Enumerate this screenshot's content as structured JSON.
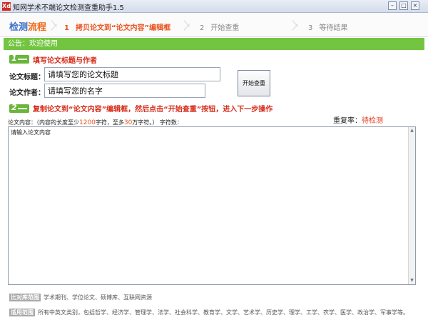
{
  "window": {
    "title": "知网学术不端论文检测查重助手1.5",
    "icon": "app-logo-icon",
    "buttons": [
      "minimize-icon",
      "maximize-icon",
      "close-icon"
    ]
  },
  "steps": {
    "title_part1": "检测",
    "title_part2": "流程",
    "items": [
      {
        "num": "1",
        "label": "拷贝论文到“论文内容”编辑框"
      },
      {
        "num": "2",
        "label": "开始查重"
      },
      {
        "num": "3",
        "label": "等待结果"
      }
    ]
  },
  "notice": "公告：欢迎使用",
  "section1": {
    "badge": "1",
    "heading": "填写论文标题与作者"
  },
  "form": {
    "title_label": "论文标题：",
    "title_value": "请填写您的论文标题",
    "author_label": "论文作者：",
    "author_value": "请填写您的名字",
    "check_button": "开始查重"
  },
  "section2": {
    "badge": "2",
    "heading": "复制论文到“论文内容”编辑框，然后点击“开始查重”按钮，进入下一步操作"
  },
  "content": {
    "label_prefix": "论文内容：（内容的长度至少",
    "min_chars": "1200",
    "label_mid": "字符，至多",
    "max_chars": "30",
    "label_suffix": "万字符。）  字符数：",
    "placeholder": "请输入论文内容"
  },
  "repeat": {
    "label": "重复率：",
    "status": "待检测"
  },
  "footer": {
    "compare_tag": "比对库范围",
    "compare_text": "学术期刊、学位论文、硕博库、互联网资源",
    "scope_tag": "适用范围",
    "scope_text": "所有中英文类别，包括哲学、经济学、管理学、法学、社会科学、教育学、文学、艺术学、历史学、理学、工学、农学、医学、政治学、军事学等。"
  },
  "colors": {
    "accent_green": "#73c541",
    "accent_red": "#d72a18",
    "accent_orange": "#e8541f",
    "step_blue": "#3c6fc8"
  }
}
